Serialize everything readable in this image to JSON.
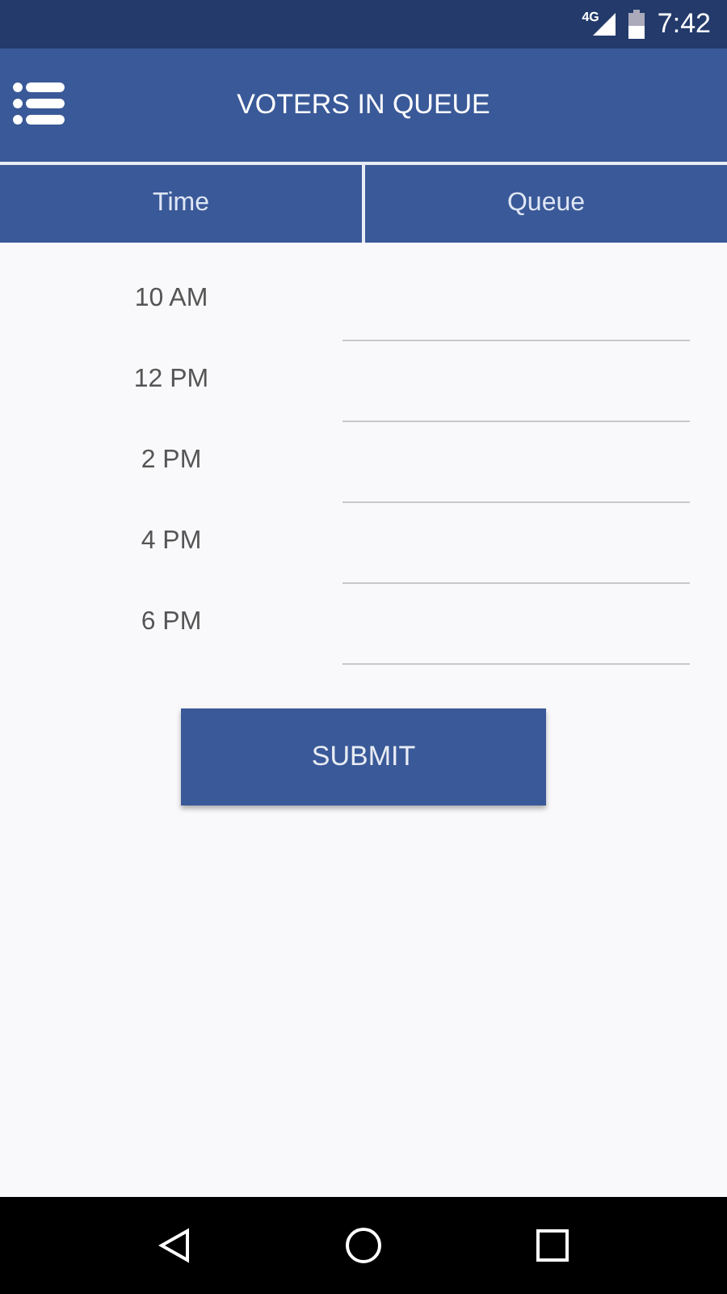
{
  "status_bar": {
    "network": "4G",
    "time": "7:42"
  },
  "app_bar": {
    "title": "VOTERS IN QUEUE"
  },
  "columns": [
    "Time",
    "Queue"
  ],
  "rows": [
    {
      "time": "10 AM"
    },
    {
      "time": "12 PM"
    },
    {
      "time": "2 PM"
    },
    {
      "time": "4 PM"
    },
    {
      "time": "6 PM"
    }
  ],
  "submit_button": "SUBMIT"
}
